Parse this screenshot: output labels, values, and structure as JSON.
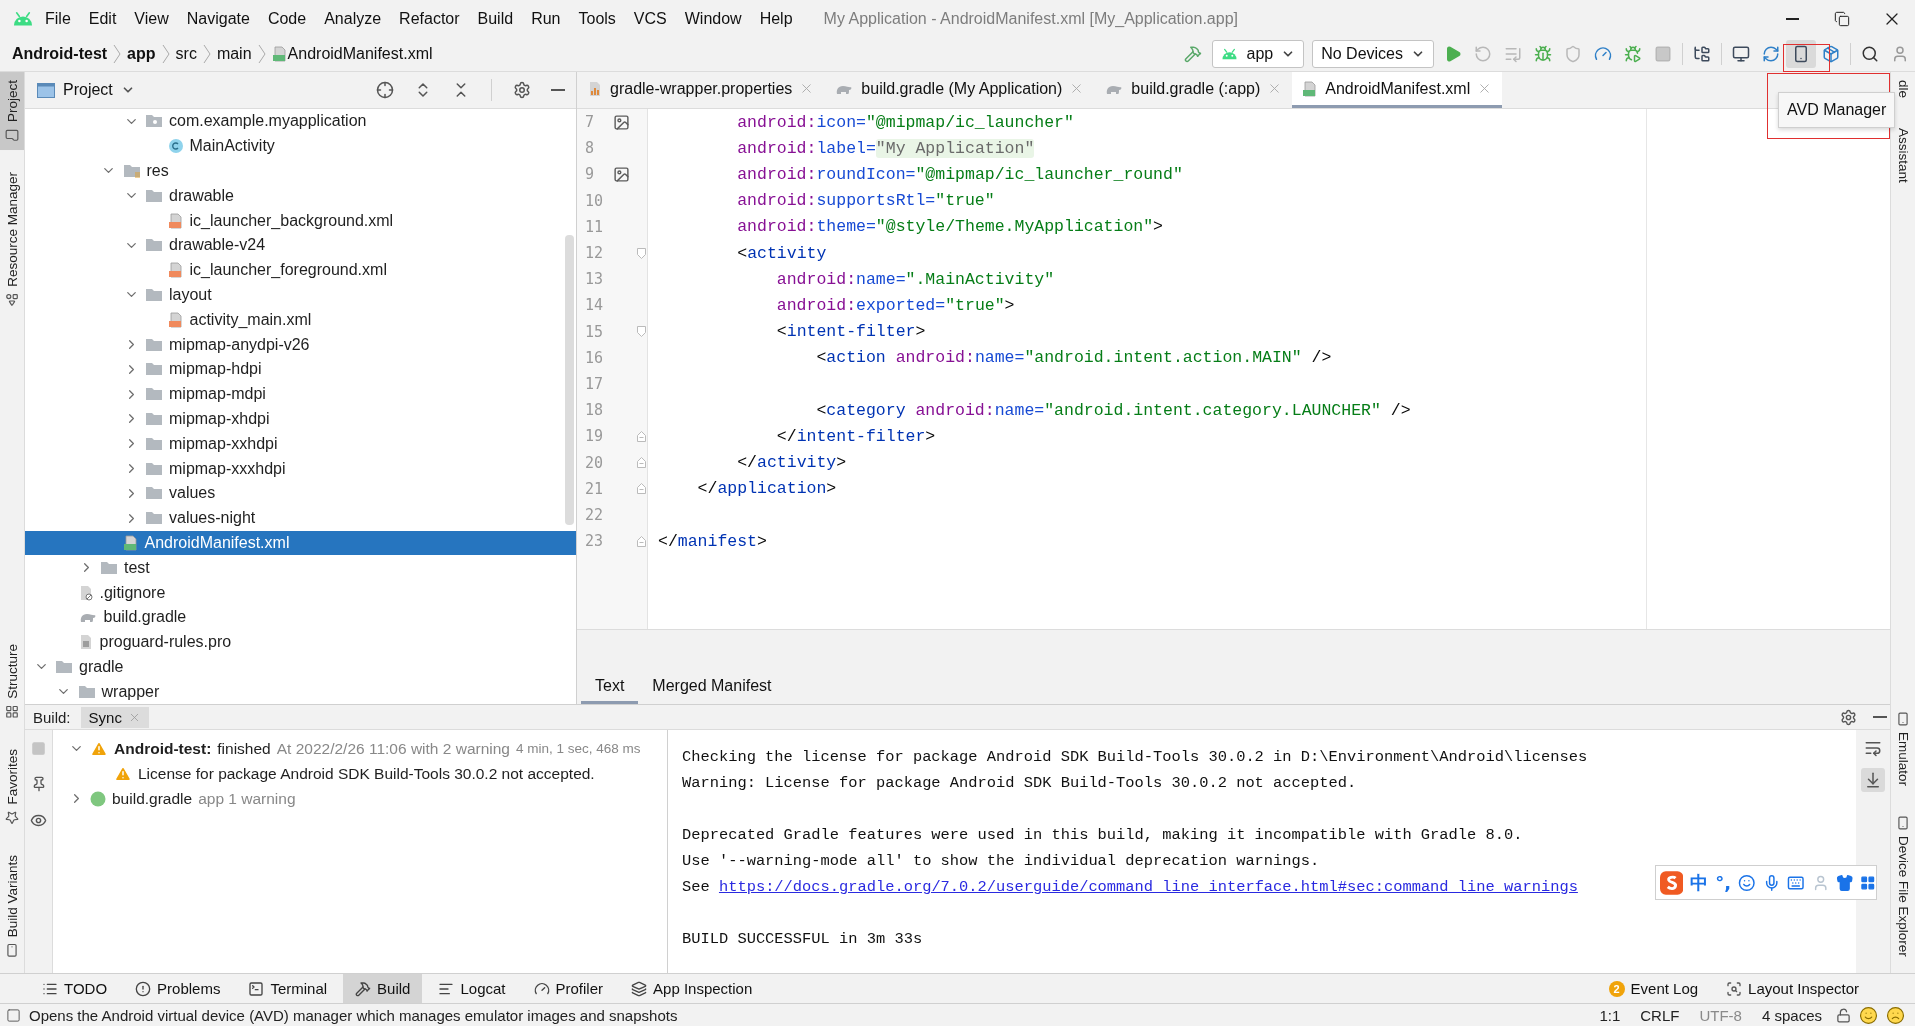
{
  "menu_bar": {
    "items": [
      "File",
      "Edit",
      "View",
      "Navigate",
      "Code",
      "Analyze",
      "Refactor",
      "Build",
      "Run",
      "Tools",
      "VCS",
      "Window",
      "Help"
    ],
    "title": "My Application - AndroidManifest.xml [My_Application.app]"
  },
  "breadcrumbs": [
    {
      "label": "Android-test",
      "kind": "module"
    },
    {
      "label": "app",
      "kind": "module"
    },
    {
      "label": "src",
      "kind": "folder"
    },
    {
      "label": "main",
      "kind": "folder"
    },
    {
      "label": "AndroidManifest.xml",
      "kind": "manifest"
    }
  ],
  "toolbar": {
    "config": "app",
    "device": "No Devices",
    "buttons": [
      {
        "kind": "build",
        "disabled": false,
        "pressed": false
      },
      {
        "kind": "run",
        "disabled": false,
        "pressed": false
      },
      {
        "kind": "apply-restart",
        "disabled": true,
        "pressed": false
      },
      {
        "kind": "apply-code",
        "disabled": true,
        "pressed": false
      },
      {
        "kind": "debug",
        "disabled": false,
        "pressed": false
      },
      {
        "kind": "attach-profiler",
        "disabled": true,
        "pressed": false
      },
      {
        "kind": "profiler",
        "disabled": false,
        "pressed": false
      },
      {
        "kind": "attach-debugger",
        "disabled": false,
        "pressed": false
      },
      {
        "kind": "stop",
        "disabled": true,
        "pressed": false
      },
      {
        "kind": "project-structure",
        "disabled": false,
        "pressed": false
      },
      {
        "kind": "screen",
        "disabled": false,
        "pressed": false
      },
      {
        "kind": "sync",
        "disabled": false,
        "pressed": false
      },
      {
        "kind": "avd",
        "disabled": false,
        "pressed": true
      },
      {
        "kind": "sdk",
        "disabled": false,
        "pressed": false
      },
      {
        "kind": "search",
        "disabled": false,
        "pressed": false
      },
      {
        "kind": "account",
        "disabled": false,
        "pressed": false
      }
    ]
  },
  "tooltip": {
    "text": "AVD Manager"
  },
  "left_stripe": {
    "top": [
      {
        "label": "Project",
        "selected": true
      },
      {
        "label": "Resource Manager",
        "selected": false
      }
    ],
    "bottom": [
      {
        "label": "Structure",
        "selected": false
      },
      {
        "label": "Favorites",
        "selected": false
      },
      {
        "label": "Build Variants",
        "selected": false
      }
    ]
  },
  "right_stripe": {
    "top": [
      {
        "label": "dle"
      },
      {
        "label": "Assistant"
      }
    ],
    "bottom": [
      {
        "label": "Emulator"
      },
      {
        "label": "Device File Explorer"
      }
    ]
  },
  "project_panel": {
    "title": "Project",
    "tree": [
      {
        "children": [
          {
            "children": [
              {
                "children": [
                  {
                    "children": [
                      {
                        "label": "com.example.myapplication",
                        "kind": "package",
                        "expanded": true,
                        "selected": false,
                        "children": [
                          {
                            "label": "MainActivity",
                            "kind": "class",
                            "selected": false
                          }
                        ]
                      }
                    ]
                  },
                  {
                    "label": "res",
                    "kind": "res-folder",
                    "expanded": true,
                    "selected": false,
                    "children": [
                      {
                        "label": "drawable",
                        "kind": "folder",
                        "expanded": true,
                        "selected": false,
                        "children": [
                          {
                            "label": "ic_launcher_background.xml",
                            "kind": "xml",
                            "selected": false
                          }
                        ]
                      },
                      {
                        "label": "drawable-v24",
                        "kind": "folder",
                        "expanded": true,
                        "selected": false,
                        "children": [
                          {
                            "label": "ic_launcher_foreground.xml",
                            "kind": "xml",
                            "selected": false
                          }
                        ]
                      },
                      {
                        "label": "layout",
                        "kind": "folder",
                        "expanded": true,
                        "selected": false,
                        "children": [
                          {
                            "label": "activity_main.xml",
                            "kind": "xml",
                            "selected": false
                          }
                        ]
                      },
                      {
                        "label": "mipmap-anydpi-v26",
                        "kind": "folder",
                        "expanded": false,
                        "selected": false
                      },
                      {
                        "label": "mipmap-hdpi",
                        "kind": "folder",
                        "expanded": false,
                        "selected": false
                      },
                      {
                        "label": "mipmap-mdpi",
                        "kind": "folder",
                        "expanded": false,
                        "selected": false
                      },
                      {
                        "label": "mipmap-xhdpi",
                        "kind": "folder",
                        "expanded": false,
                        "selected": false
                      },
                      {
                        "label": "mipmap-xxhdpi",
                        "kind": "folder",
                        "expanded": false,
                        "selected": false
                      },
                      {
                        "label": "mipmap-xxxhdpi",
                        "kind": "folder",
                        "expanded": false,
                        "selected": false
                      },
                      {
                        "label": "values",
                        "kind": "folder",
                        "expanded": false,
                        "selected": false
                      },
                      {
                        "label": "values-night",
                        "kind": "folder",
                        "expanded": false,
                        "selected": false
                      }
                    ]
                  },
                  {
                    "label": "AndroidManifest.xml",
                    "kind": "manifest",
                    "selected": true
                  }
                ]
              },
              {
                "label": "test",
                "kind": "folder",
                "expanded": false,
                "selected": false
              }
            ]
          },
          {
            "label": ".gitignore",
            "kind": "gitignore",
            "selected": false
          },
          {
            "label": "build.gradle",
            "kind": "gradle",
            "selected": false
          },
          {
            "label": "proguard-rules.pro",
            "kind": "text",
            "selected": false
          }
        ]
      },
      {
        "label": "gradle",
        "kind": "folder",
        "expanded": true,
        "selected": false,
        "children": [
          {
            "label": "wrapper",
            "kind": "folder",
            "expanded": true,
            "selected": false
          }
        ]
      }
    ]
  },
  "editor": {
    "tabs": [
      {
        "label": "gradle-wrapper.properties",
        "kind": "properties",
        "selected": false
      },
      {
        "label": "build.gradle (My Application)",
        "kind": "gradle",
        "selected": false
      },
      {
        "label": "build.gradle (:app)",
        "kind": "gradle",
        "selected": false
      },
      {
        "label": "AndroidManifest.xml",
        "kind": "manifest",
        "selected": true
      }
    ],
    "lines": [
      {
        "number": "7",
        "kind": "image",
        "tokens": [
          {
            "kind": "ns",
            "text": "        android:"
          },
          {
            "kind": "attr",
            "text": "icon="
          },
          {
            "kind": "value",
            "text": "\"@mipmap/ic_launcher\""
          }
        ]
      },
      {
        "number": "8",
        "kind": "plain",
        "tokens": [
          {
            "kind": "ns",
            "text": "        android:"
          },
          {
            "kind": "attr",
            "text": "label="
          },
          {
            "kind": "folded",
            "text": "\"My Application\""
          }
        ]
      },
      {
        "number": "9",
        "kind": "image",
        "tokens": [
          {
            "kind": "ns",
            "text": "        android:"
          },
          {
            "kind": "attr",
            "text": "roundIcon="
          },
          {
            "kind": "value",
            "text": "\"@mipmap/ic_launcher_round\""
          }
        ]
      },
      {
        "number": "10",
        "kind": "plain",
        "tokens": [
          {
            "kind": "ns",
            "text": "        android:"
          },
          {
            "kind": "attr",
            "text": "supportsRtl="
          },
          {
            "kind": "value",
            "text": "\"true\""
          }
        ]
      },
      {
        "number": "11",
        "kind": "plain",
        "tokens": [
          {
            "kind": "ns",
            "text": "        android:"
          },
          {
            "kind": "attr",
            "text": "theme="
          },
          {
            "kind": "value",
            "text": "\"@style/Theme.MyApplication\""
          },
          {
            "kind": "punct",
            "text": ">"
          }
        ]
      },
      {
        "number": "12",
        "kind": "fold-start",
        "tokens": [
          {
            "kind": "punct",
            "text": "        <"
          },
          {
            "kind": "tag",
            "text": "activity"
          }
        ]
      },
      {
        "number": "13",
        "kind": "plain",
        "tokens": [
          {
            "kind": "ns",
            "text": "            android:"
          },
          {
            "kind": "attr",
            "text": "name="
          },
          {
            "kind": "value",
            "text": "\".MainActivity\""
          }
        ]
      },
      {
        "number": "14",
        "kind": "plain",
        "tokens": [
          {
            "kind": "ns",
            "text": "            android:"
          },
          {
            "kind": "attr",
            "text": "exported="
          },
          {
            "kind": "value",
            "text": "\"true\""
          },
          {
            "kind": "punct",
            "text": ">"
          }
        ]
      },
      {
        "number": "15",
        "kind": "fold-start",
        "tokens": [
          {
            "kind": "punct",
            "text": "            <"
          },
          {
            "kind": "tag",
            "text": "intent-filter"
          },
          {
            "kind": "punct",
            "text": ">"
          }
        ]
      },
      {
        "number": "16",
        "kind": "plain",
        "tokens": [
          {
            "kind": "punct",
            "text": "                <"
          },
          {
            "kind": "tag",
            "text": "action"
          },
          {
            "kind": "ns",
            "text": " android:"
          },
          {
            "kind": "attr",
            "text": "name="
          },
          {
            "kind": "value",
            "text": "\"android.intent.action.MAIN\""
          },
          {
            "kind": "punct",
            "text": " />"
          }
        ]
      },
      {
        "number": "17",
        "kind": "plain"
      },
      {
        "number": "18",
        "kind": "plain",
        "tokens": [
          {
            "kind": "punct",
            "text": "                <"
          },
          {
            "kind": "tag",
            "text": "category"
          },
          {
            "kind": "ns",
            "text": " android:"
          },
          {
            "kind": "attr",
            "text": "name="
          },
          {
            "kind": "value",
            "text": "\"android.intent.category.LAUNCHER\""
          },
          {
            "kind": "punct",
            "text": " />"
          }
        ]
      },
      {
        "number": "19",
        "kind": "fold-end",
        "tokens": [
          {
            "kind": "punct",
            "text": "            </"
          },
          {
            "kind": "tag",
            "text": "intent-filter"
          },
          {
            "kind": "punct",
            "text": ">"
          }
        ]
      },
      {
        "number": "20",
        "kind": "fold-end",
        "tokens": [
          {
            "kind": "punct",
            "text": "        </"
          },
          {
            "kind": "tag",
            "text": "activity"
          },
          {
            "kind": "punct",
            "text": ">"
          }
        ]
      },
      {
        "number": "21",
        "kind": "fold-end",
        "tokens": [
          {
            "kind": "punct",
            "text": "    </"
          },
          {
            "kind": "tag",
            "text": "application"
          },
          {
            "kind": "punct",
            "text": ">"
          }
        ]
      },
      {
        "number": "22",
        "kind": "plain"
      },
      {
        "number": "23",
        "kind": "fold-end",
        "tokens": [
          {
            "kind": "punct",
            "text": "</"
          },
          {
            "kind": "tag",
            "text": "manifest"
          },
          {
            "kind": "punct",
            "text": ">"
          }
        ]
      }
    ],
    "bottom_tabs": [
      {
        "label": "Text",
        "selected": true
      },
      {
        "label": "Merged Manifest",
        "selected": false
      }
    ]
  },
  "build_panel": {
    "label": "Build:",
    "tabs": [
      {
        "label": "Sync",
        "selected": true
      }
    ],
    "tree": [
      {
        "kind": "summary",
        "label": "Android-test:",
        "status": "finished",
        "detail": "At 2022/2/26 11:06 with 2 warning",
        "time": "4 min, 1 sec, 468 ms",
        "expanded": true,
        "children": [
          {
            "kind": "warning",
            "label": "License for package Android SDK Build-Tools 30.0.2 not accepted."
          }
        ]
      },
      {
        "kind": "gradle-file",
        "label": "build.gradle",
        "detail": "app 1 warning",
        "expanded": false
      }
    ],
    "console": [
      {
        "kind": "text",
        "text": "Checking the license for package Android SDK Build-Tools 30.0.2 in D:\\Environment\\Android\\licenses"
      },
      {
        "kind": "text",
        "text": "Warning: License for package Android SDK Build-Tools 30.0.2 not accepted."
      },
      {
        "kind": "blank"
      },
      {
        "kind": "text",
        "text": "Deprecated Gradle features were used in this build, making it incompatible with Gradle 8.0."
      },
      {
        "kind": "text",
        "text": "Use '--warning-mode all' to show the individual deprecation warnings."
      },
      {
        "kind": "link",
        "text": "See",
        "link": "https://docs.gradle.org/7.0.2/userguide/command_line_interface.html#sec:command_line_warnings"
      },
      {
        "kind": "blank"
      },
      {
        "kind": "text",
        "text": "BUILD SUCCESSFUL in 3m 33s"
      }
    ]
  },
  "ime_toolbar": {
    "language": "中",
    "punctuation": "°,"
  },
  "tool_tabs": [
    {
      "label": "TODO",
      "kind": "todo",
      "selected": false
    },
    {
      "label": "Problems",
      "kind": "problems",
      "selected": false
    },
    {
      "label": "Terminal",
      "kind": "terminal",
      "selected": false
    },
    {
      "label": "Build",
      "kind": "build",
      "selected": true
    },
    {
      "label": "Logcat",
      "kind": "logcat",
      "selected": false
    },
    {
      "label": "Profiler",
      "kind": "profiler",
      "selected": false
    },
    {
      "label": "App Inspection",
      "kind": "inspection",
      "selected": false
    }
  ],
  "right_tool_tabs": [
    {
      "label": "Event Log",
      "badge": "2",
      "kind": "event-log"
    },
    {
      "label": "Layout Inspector",
      "kind": "layout-inspector"
    }
  ],
  "status_bar": {
    "message": "Opens the Android virtual device (AVD) manager which manages emulator images and snapshots",
    "items": [
      {
        "text": "1:1",
        "disabled": false
      },
      {
        "text": "CRLF",
        "disabled": false
      },
      {
        "text": "UTF-8",
        "disabled": true
      },
      {
        "text": "4 spaces",
        "disabled": false
      }
    ]
  }
}
